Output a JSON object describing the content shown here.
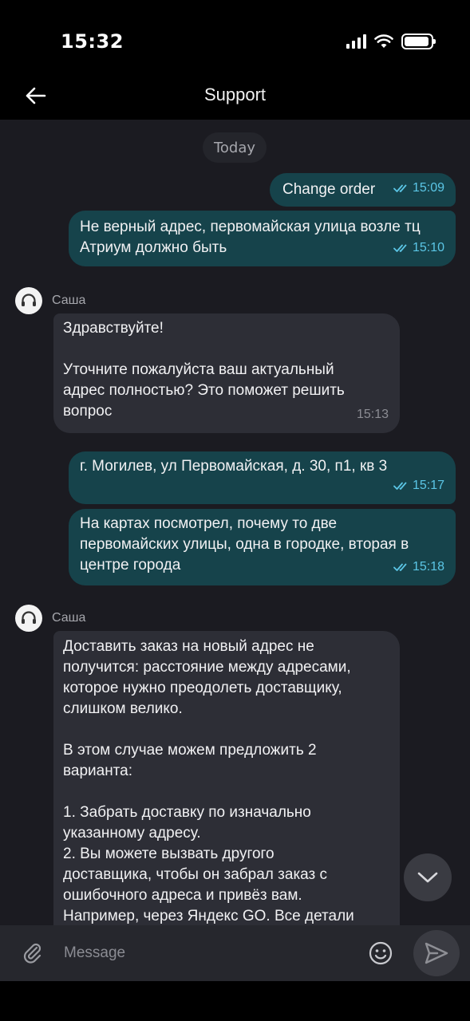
{
  "status_bar": {
    "time": "15:32"
  },
  "header": {
    "title": "Support"
  },
  "chat": {
    "date_label": "Today",
    "messages": [
      {
        "dir": "out",
        "text": "Change order",
        "time": "15:09",
        "read": true
      },
      {
        "dir": "out",
        "text": "Не верный адрес, первомайская улица возле тц\nАтриум должно быть",
        "time": "15:10",
        "read": true
      },
      {
        "dir": "in",
        "sender": "Саша",
        "text": "Здравствуйте!\n\nУточните пожалуйста ваш актуальный\nадрес полностью? Это поможет решить\nвопрос",
        "time": "15:13"
      },
      {
        "dir": "out",
        "text": "г. Могилев, ул Первомайская, д. 30, п1, кв 3",
        "time": "15:17",
        "read": true
      },
      {
        "dir": "out",
        "text": "На картах посмотрел, почему то две\nпервомайских улицы, одна в городке, вторая в\nцентре города",
        "time": "15:18",
        "read": true
      },
      {
        "dir": "in",
        "sender": "Саша",
        "text": "Доставить заказ на новый адрес не\nполучится: расстояние между адресами,\nкоторое нужно преодолеть доставщику,\nслишком велико.\n\nВ этом случае можем предложить 2\nварианта:\n\n1. Забрать доставку по изначально\nуказанному адресу.\n2. Вы можете вызвать другого\nдоставщика, чтобы он забрал заказ с\nошибочного адреса и привёз вам.\nНапример, через Яндекс GO. Все детали"
      }
    ]
  },
  "composer": {
    "placeholder": "Message"
  },
  "colors": {
    "outgoing_bubble": "#16434b",
    "incoming_bubble": "#2d2e36",
    "read_ticks": "#5bc6e6",
    "chat_bg": "#1b1b21"
  },
  "icons": [
    "back-arrow-icon",
    "attach-paperclip-icon",
    "emoji-icon",
    "send-icon",
    "chevron-down-icon",
    "headset-icon"
  ]
}
